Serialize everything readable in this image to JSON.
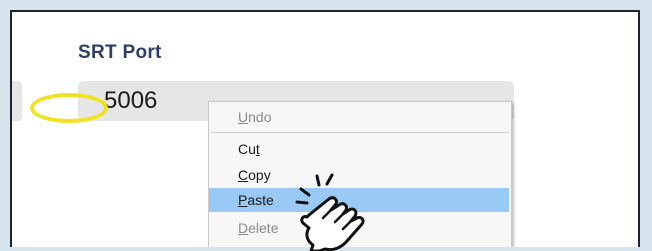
{
  "field": {
    "label": "SRT Port",
    "value": "5006"
  },
  "context_menu": {
    "items": [
      {
        "label": "Undo",
        "disabled": true
      },
      {
        "label": "Cut",
        "disabled": false
      },
      {
        "label": "Copy",
        "disabled": false
      },
      {
        "label": "Paste",
        "disabled": false,
        "highlighted": true
      },
      {
        "label": "Delete",
        "disabled": true
      }
    ]
  },
  "annotation": {
    "ring_color": "#f1e21f",
    "cursor_icon": "hand-pointer-icon"
  },
  "colors": {
    "background": "#d6e4ee",
    "label_text": "#2e3e6a",
    "input_bg": "#e6e6e6",
    "menu_highlight": "#99c9f5"
  }
}
